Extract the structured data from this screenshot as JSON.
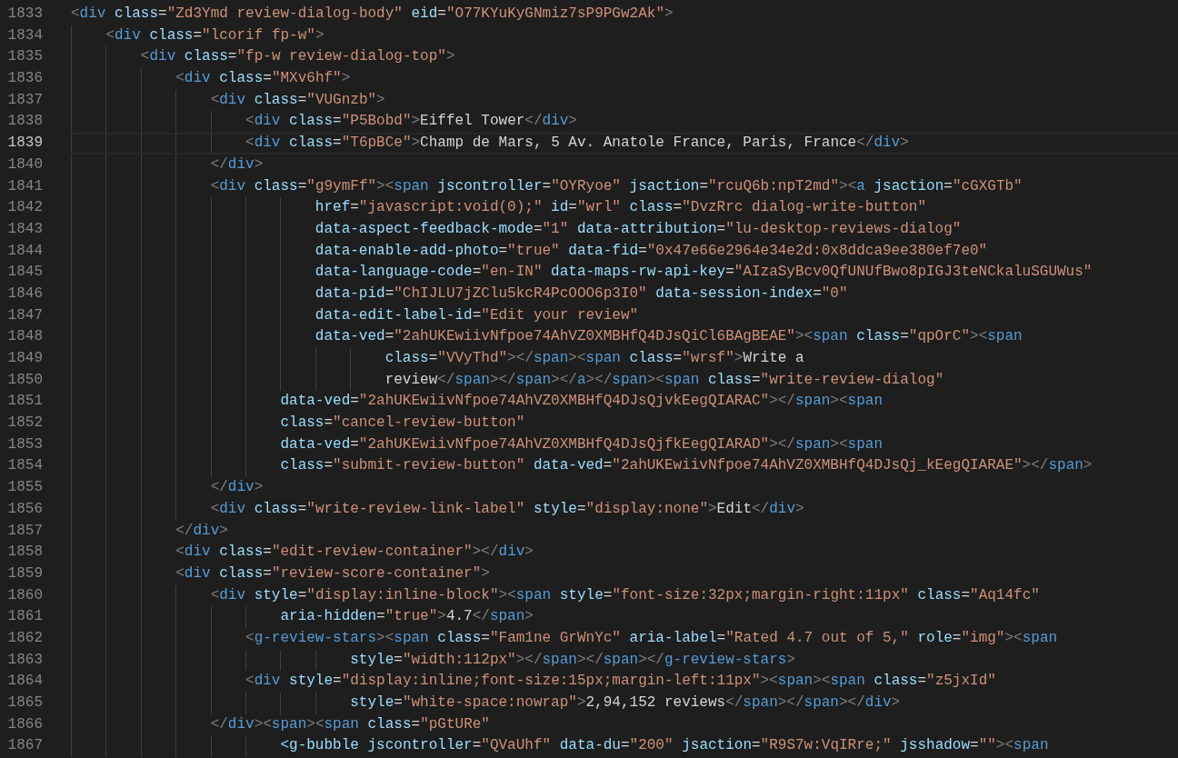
{
  "editor": {
    "lines": [
      {
        "number": "1833",
        "text": "<div class=\"Zd3Ymd review-dialog-body\" eid=\"O77KYuKyGNmiz7sP9PGw2Ak\">",
        "current": false
      },
      {
        "number": "1834",
        "text": "    <div class=\"lcorif fp-w\">",
        "current": false
      },
      {
        "number": "1835",
        "text": "        <div class=\"fp-w review-dialog-top\">",
        "current": false
      },
      {
        "number": "1836",
        "text": "            <div class=\"MXv6hf\">",
        "current": false
      },
      {
        "number": "1837",
        "text": "                <div class=\"VUGnzb\">",
        "current": false
      },
      {
        "number": "1838",
        "text": "                    <div class=\"P5Bobd\">Eiffel Tower</div>",
        "current": false
      },
      {
        "number": "1839",
        "text": "                    <div class=\"T6pBCe\">Champ de Mars, 5 Av. Anatole France, Paris, France</div>",
        "current": true
      },
      {
        "number": "1840",
        "text": "                </div>",
        "current": false
      },
      {
        "number": "1841",
        "text": "                <div class=\"g9ymFf\"><span jscontroller=\"OYRyoe\" jsaction=\"rcuQ6b:npT2md\"><a jsaction=\"cGXGTb\"",
        "current": false
      },
      {
        "number": "1842",
        "text": "                            href=\"javascript:void(0);\" id=\"wrl\" class=\"DvzRrc dialog-write-button\"",
        "current": false
      },
      {
        "number": "1843",
        "text": "                            data-aspect-feedback-mode=\"1\" data-attribution=\"lu-desktop-reviews-dialog\"",
        "current": false
      },
      {
        "number": "1844",
        "text": "                            data-enable-add-photo=\"true\" data-fid=\"0x47e66e2964e34e2d:0x8ddca9ee380ef7e0\"",
        "current": false
      },
      {
        "number": "1845",
        "text": "                            data-language-code=\"en-IN\" data-maps-rw-api-key=\"AIzaSyBcv0QfUNUfBwo8pIGJ3teNCkaluSGUWus\"",
        "current": false
      },
      {
        "number": "1846",
        "text": "                            data-pid=\"ChIJLU7jZClu5kcR4PcOOO6p3I0\" data-session-index=\"0\"",
        "current": false
      },
      {
        "number": "1847",
        "text": "                            data-edit-label-id=\"Edit your review\"",
        "current": false
      },
      {
        "number": "1848",
        "text": "                            data-ved=\"2ahUKEwiivNfpoe74AhVZ0XMBHfQ4DJsQiCl6BAgBEAE\"><span class=\"qpOrC\"><span",
        "current": false
      },
      {
        "number": "1849",
        "text": "                                    class=\"VVyThd\"></span><span class=\"wrsf\">Write a",
        "current": false
      },
      {
        "number": "1850",
        "text": "                                    review</span></span></a></span><span class=\"write-review-dialog\"",
        "current": false
      },
      {
        "number": "1851",
        "text": "                        data-ved=\"2ahUKEwiivNfpoe74AhVZ0XMBHfQ4DJsQjvkEegQIARAC\"></span><span",
        "current": false
      },
      {
        "number": "1852",
        "text": "                        class=\"cancel-review-button\"",
        "current": false
      },
      {
        "number": "1853",
        "text": "                        data-ved=\"2ahUKEwiivNfpoe74AhVZ0XMBHfQ4DJsQjfkEegQIARAD\"></span><span",
        "current": false
      },
      {
        "number": "1854",
        "text": "                        class=\"submit-review-button\" data-ved=\"2ahUKEwiivNfpoe74AhVZ0XMBHfQ4DJsQj_kEegQIARAE\"></span>",
        "current": false
      },
      {
        "number": "1855",
        "text": "                </div>",
        "current": false
      },
      {
        "number": "1856",
        "text": "                <div class=\"write-review-link-label\" style=\"display:none\">Edit</div>",
        "current": false
      },
      {
        "number": "1857",
        "text": "            </div>",
        "current": false
      },
      {
        "number": "1858",
        "text": "            <div class=\"edit-review-container\"></div>",
        "current": false
      },
      {
        "number": "1859",
        "text": "            <div class=\"review-score-container\">",
        "current": false
      },
      {
        "number": "1860",
        "text": "                <div style=\"display:inline-block\"><span style=\"font-size:32px;margin-right:11px\" class=\"Aq14fc\"",
        "current": false
      },
      {
        "number": "1861",
        "text": "                        aria-hidden=\"true\">4.7</span>",
        "current": false
      },
      {
        "number": "1862",
        "text": "                    <g-review-stars><span class=\"Fam1ne GrWnYc\" aria-label=\"Rated 4.7 out of 5,\" role=\"img\"><span",
        "current": false
      },
      {
        "number": "1863",
        "text": "                                style=\"width:112px\"></span></span></g-review-stars>",
        "current": false
      },
      {
        "number": "1864",
        "text": "                    <div style=\"display:inline;font-size:15px;margin-left:11px\"><span><span class=\"z5jxId\"",
        "current": false
      },
      {
        "number": "1865",
        "text": "                                style=\"white-space:nowrap\">2,94,152 reviews</span></span></div>",
        "current": false
      },
      {
        "number": "1866",
        "text": "                </div><span><span class=\"pGtURe\"",
        "current": false
      },
      {
        "number": "1867",
        "text": "                        <g-bubble jscontroller=\"QVaUhf\" data-du=\"200\" jsaction=\"R9S7w:VqIRre;\" jsshadow=\"\"><span",
        "current": false
      }
    ]
  }
}
